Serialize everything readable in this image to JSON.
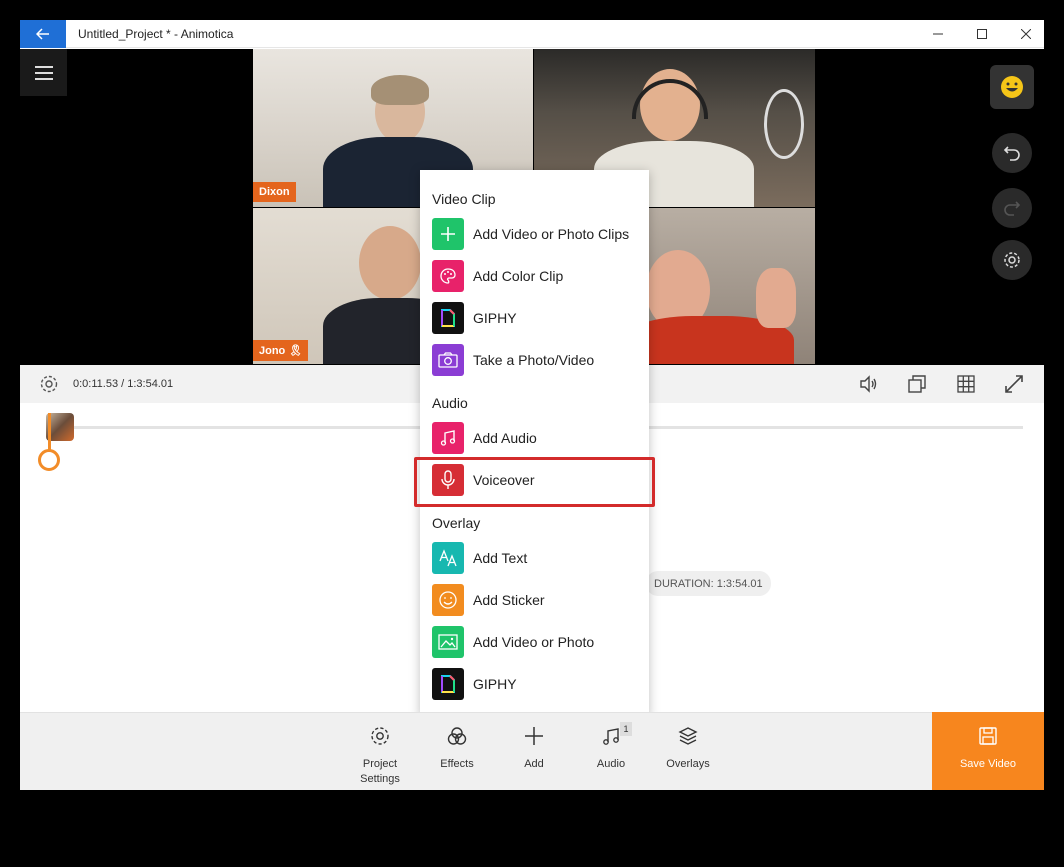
{
  "window": {
    "title": "Untitled_Project * - Animotica"
  },
  "video": {
    "participants": [
      {
        "name": "Dixon"
      },
      {
        "name": ""
      },
      {
        "name": "Jono 🎗"
      },
      {
        "name": ""
      }
    ]
  },
  "playback": {
    "time": "0:0:11.53 / 1:3:54.01"
  },
  "timeline": {
    "duration": "DURATION: 1:3:54.01"
  },
  "add_menu": {
    "sections": [
      {
        "header": "Video Clip",
        "items": [
          {
            "label": "Add Video or Photo Clips",
            "icon": "plus-icon",
            "color": "#1fc46a"
          },
          {
            "label": "Add Color Clip",
            "icon": "palette-icon",
            "color": "#e8226a"
          },
          {
            "label": "GIPHY",
            "icon": "giphy-icon",
            "color": "#111111"
          },
          {
            "label": "Take a Photo/Video",
            "icon": "camera-icon",
            "color": "#8b3dd4"
          }
        ]
      },
      {
        "header": "Audio",
        "items": [
          {
            "label": "Add Audio",
            "icon": "music-note-icon",
            "color": "#e8226a"
          },
          {
            "label": "Voiceover",
            "icon": "microphone-icon",
            "color": "#d62d35"
          }
        ]
      },
      {
        "header": "Overlay",
        "items": [
          {
            "label": "Add Text",
            "icon": "text-icon",
            "color": "#17b8b0"
          },
          {
            "label": "Add Sticker",
            "icon": "smiley-icon",
            "color": "#f28c1f"
          },
          {
            "label": "Add Video or Photo",
            "icon": "image-icon",
            "color": "#1fc46a"
          },
          {
            "label": "GIPHY",
            "icon": "giphy-icon",
            "color": "#111111"
          }
        ]
      }
    ]
  },
  "toolbar": {
    "project_settings": "Project Settings",
    "effects": "Effects",
    "add": "Add",
    "audio": "Audio",
    "audio_badge": "1",
    "overlays": "Overlays",
    "save": "Save Video"
  },
  "colors": {
    "accent": "#f7861e",
    "titlebar_back": "#1f6fd6",
    "highlight": "#d32b2b"
  }
}
